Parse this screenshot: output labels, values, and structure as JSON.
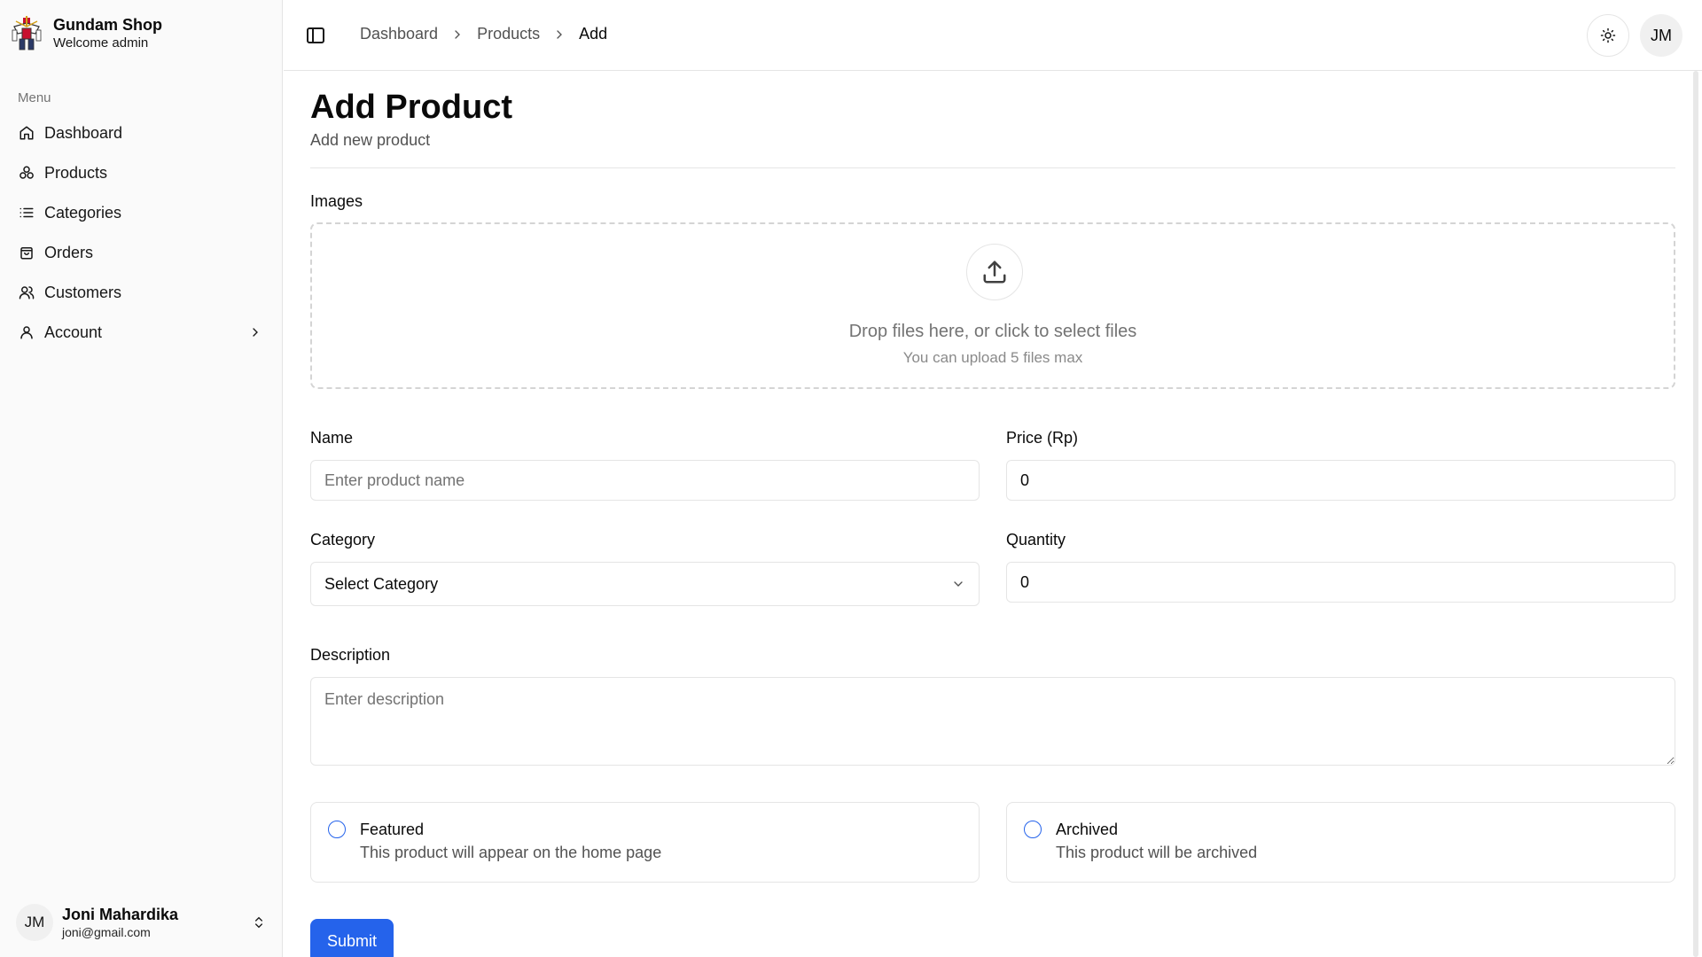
{
  "brand": {
    "name": "Gundam Shop",
    "subtitle": "Welcome admin",
    "logo_icon": "gundam-logo"
  },
  "sidebar": {
    "menu_label": "Menu",
    "items": [
      {
        "label": "Dashboard",
        "icon": "home-icon"
      },
      {
        "label": "Products",
        "icon": "boxes-icon"
      },
      {
        "label": "Categories",
        "icon": "list-icon"
      },
      {
        "label": "Orders",
        "icon": "shopping-bag-icon"
      },
      {
        "label": "Customers",
        "icon": "users-icon"
      },
      {
        "label": "Account",
        "icon": "user-icon"
      }
    ],
    "user": {
      "initials": "JM",
      "name": "Joni Mahardika",
      "email": "joni@gmail.com"
    }
  },
  "header": {
    "breadcrumb": [
      "Dashboard",
      "Products",
      "Add"
    ],
    "avatar_initials": "JM"
  },
  "page": {
    "title": "Add Product",
    "subtitle": "Add new product"
  },
  "form": {
    "images_label": "Images",
    "dropzone_text": "Drop files here, or click to select files",
    "dropzone_hint": "You can upload 5 files max",
    "name_label": "Name",
    "name_placeholder": "Enter product name",
    "name_value": "",
    "price_label": "Price (Rp)",
    "price_value": "0",
    "category_label": "Category",
    "category_value": "Select Category",
    "quantity_label": "Quantity",
    "quantity_value": "0",
    "description_label": "Description",
    "description_placeholder": "Enter description",
    "featured": {
      "title": "Featured",
      "description": "This product will appear on the home page",
      "checked": false
    },
    "archived": {
      "title": "Archived",
      "description": "This product will be archived",
      "checked": false
    },
    "submit_label": "Submit"
  },
  "colors": {
    "primary": "#2563eb",
    "border": "#e5e5e5",
    "muted": "#737373",
    "sidebar_bg": "#fafafa"
  }
}
